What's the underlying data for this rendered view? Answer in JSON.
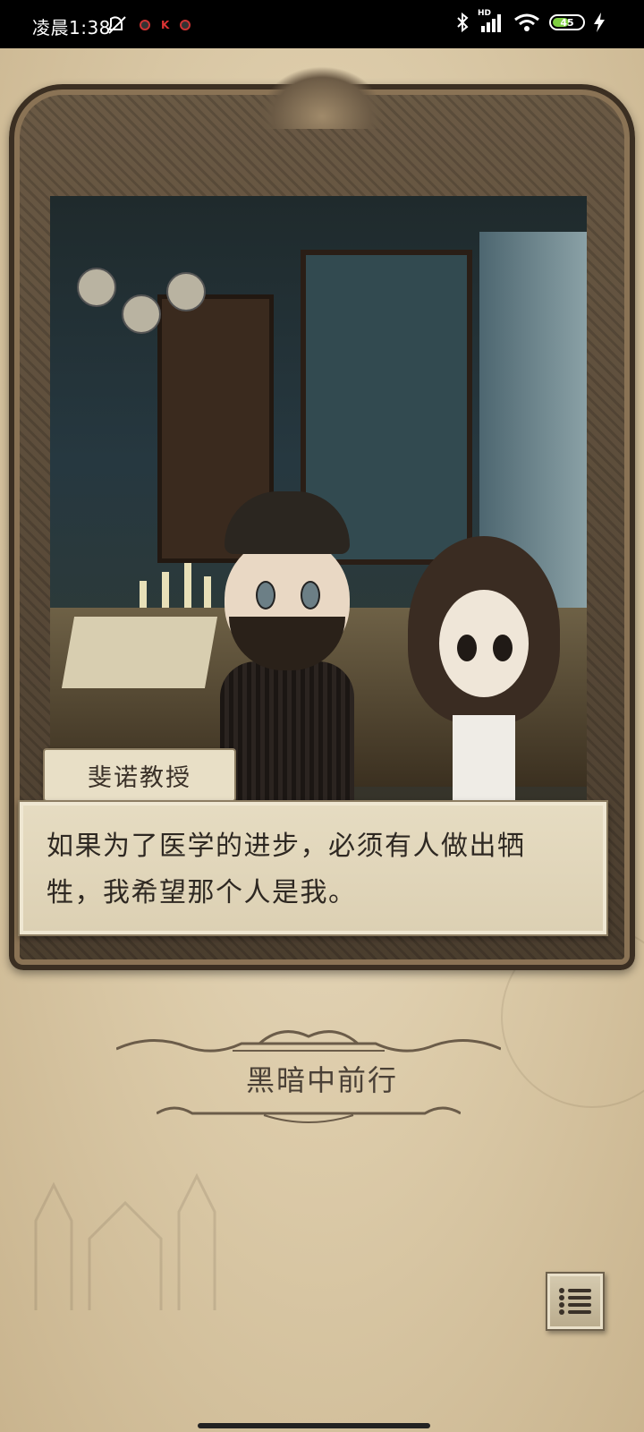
{
  "status_bar": {
    "time": "凌晨1:38",
    "battery": "45",
    "network": "HD"
  },
  "dialog": {
    "speaker": "斐诺教授",
    "text": "如果为了医学的进步，必须有人做出牺牲，我希望那个人是我。"
  },
  "chapter": {
    "title": "黑暗中前行"
  },
  "icons": [
    "mute-icon",
    "bluetooth-icon",
    "signal-icon",
    "wifi-icon",
    "battery-icon",
    "charging-icon",
    "menu-list-icon"
  ],
  "colors": {
    "parchment": "#dccba9",
    "dialog_bg": "#e6dcc2",
    "text_dark": "#2e2822"
  }
}
